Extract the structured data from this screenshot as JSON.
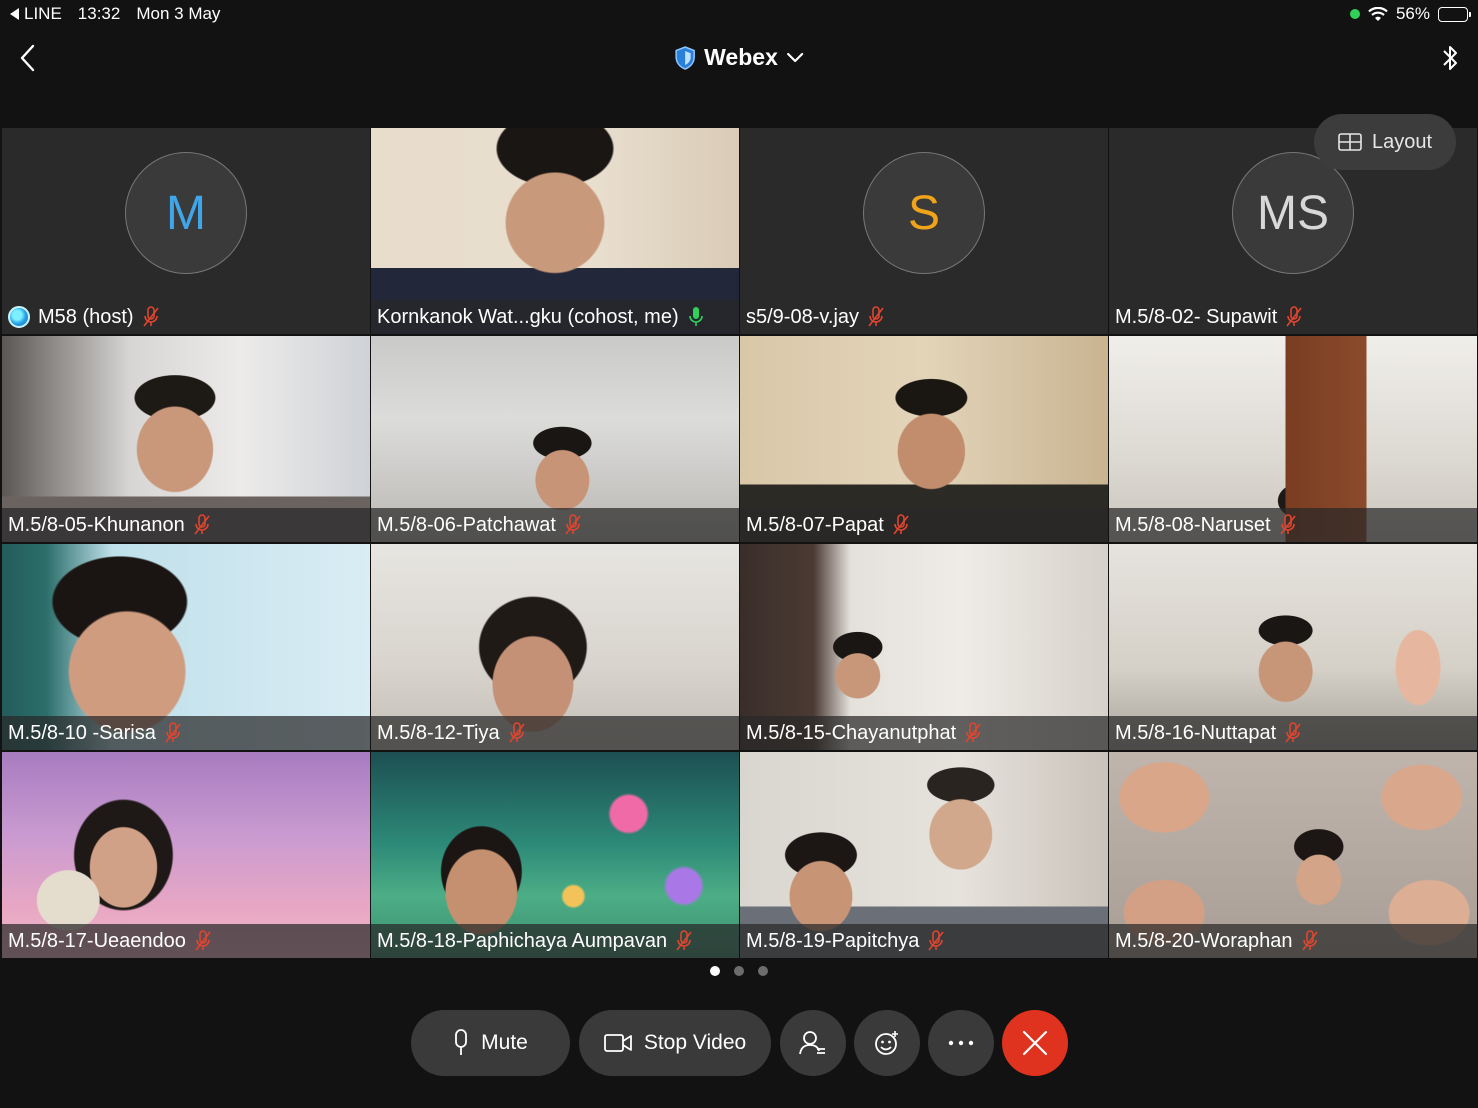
{
  "status": {
    "back_app": "LINE",
    "time": "13:32",
    "date": "Mon 3 May",
    "battery": "56%",
    "battery_level": 0.56
  },
  "header": {
    "title": "Webex"
  },
  "layout_button": {
    "label": "Layout"
  },
  "participants": [
    {
      "name": "M58 (host)",
      "initials": "M",
      "initials_color": "#3fa6ea",
      "video": false,
      "host": true,
      "mic": "muted"
    },
    {
      "name": "Kornkanok Wat...gku (cohost, me)",
      "video": true,
      "mic": "active",
      "selected": true
    },
    {
      "name": "s5/9-08-v.jay",
      "initials": "S",
      "initials_color": "#f0a41b",
      "video": false,
      "mic": "muted"
    },
    {
      "name": "M.5/8-02- Supawit",
      "initials": "MS",
      "initials_color": "#d8d8d8",
      "video": false,
      "mic": "muted"
    },
    {
      "name": "M.5/8-05-Khunanon",
      "video": true,
      "mic": "muted"
    },
    {
      "name": "M.5/8-06-Patchawat",
      "video": true,
      "mic": "muted"
    },
    {
      "name": "M.5/8-07-Papat",
      "video": true,
      "mic": "muted"
    },
    {
      "name": "M.5/8-08-Naruset",
      "video": true,
      "mic": "muted"
    },
    {
      "name": "M.5/8-10 -Sarisa",
      "video": true,
      "mic": "muted"
    },
    {
      "name": "M.5/8-12-Tiya",
      "video": true,
      "mic": "muted"
    },
    {
      "name": "M.5/8-15-Chayanutphat",
      "video": true,
      "mic": "muted"
    },
    {
      "name": "M.5/8-16-Nuttapat",
      "video": true,
      "mic": "muted"
    },
    {
      "name": "M.5/8-17-Ueaendoo",
      "video": true,
      "mic": "muted"
    },
    {
      "name": "M.5/8-18-Paphichaya Aumpavan",
      "video": true,
      "mic": "muted"
    },
    {
      "name": "M.5/8-19-Papitchya",
      "video": true,
      "mic": "muted"
    },
    {
      "name": "M.5/8-20-Woraphan",
      "video": true,
      "mic": "muted"
    }
  ],
  "pages": {
    "count": 3,
    "current": 1
  },
  "controls": {
    "mute_label": "Mute",
    "stop_video_label": "Stop Video",
    "participants_icon": "participants-icon",
    "reactions_icon": "reactions-icon",
    "more_icon": "more-icon",
    "end_icon": "end-call-icon"
  },
  "colors": {
    "background": "#121212",
    "tile": "#2a2a2a",
    "accent_selected": "#1a8fc9",
    "muted_mic": "#e0452f",
    "active_mic": "#2fd158",
    "end_button": "#e0331f"
  }
}
